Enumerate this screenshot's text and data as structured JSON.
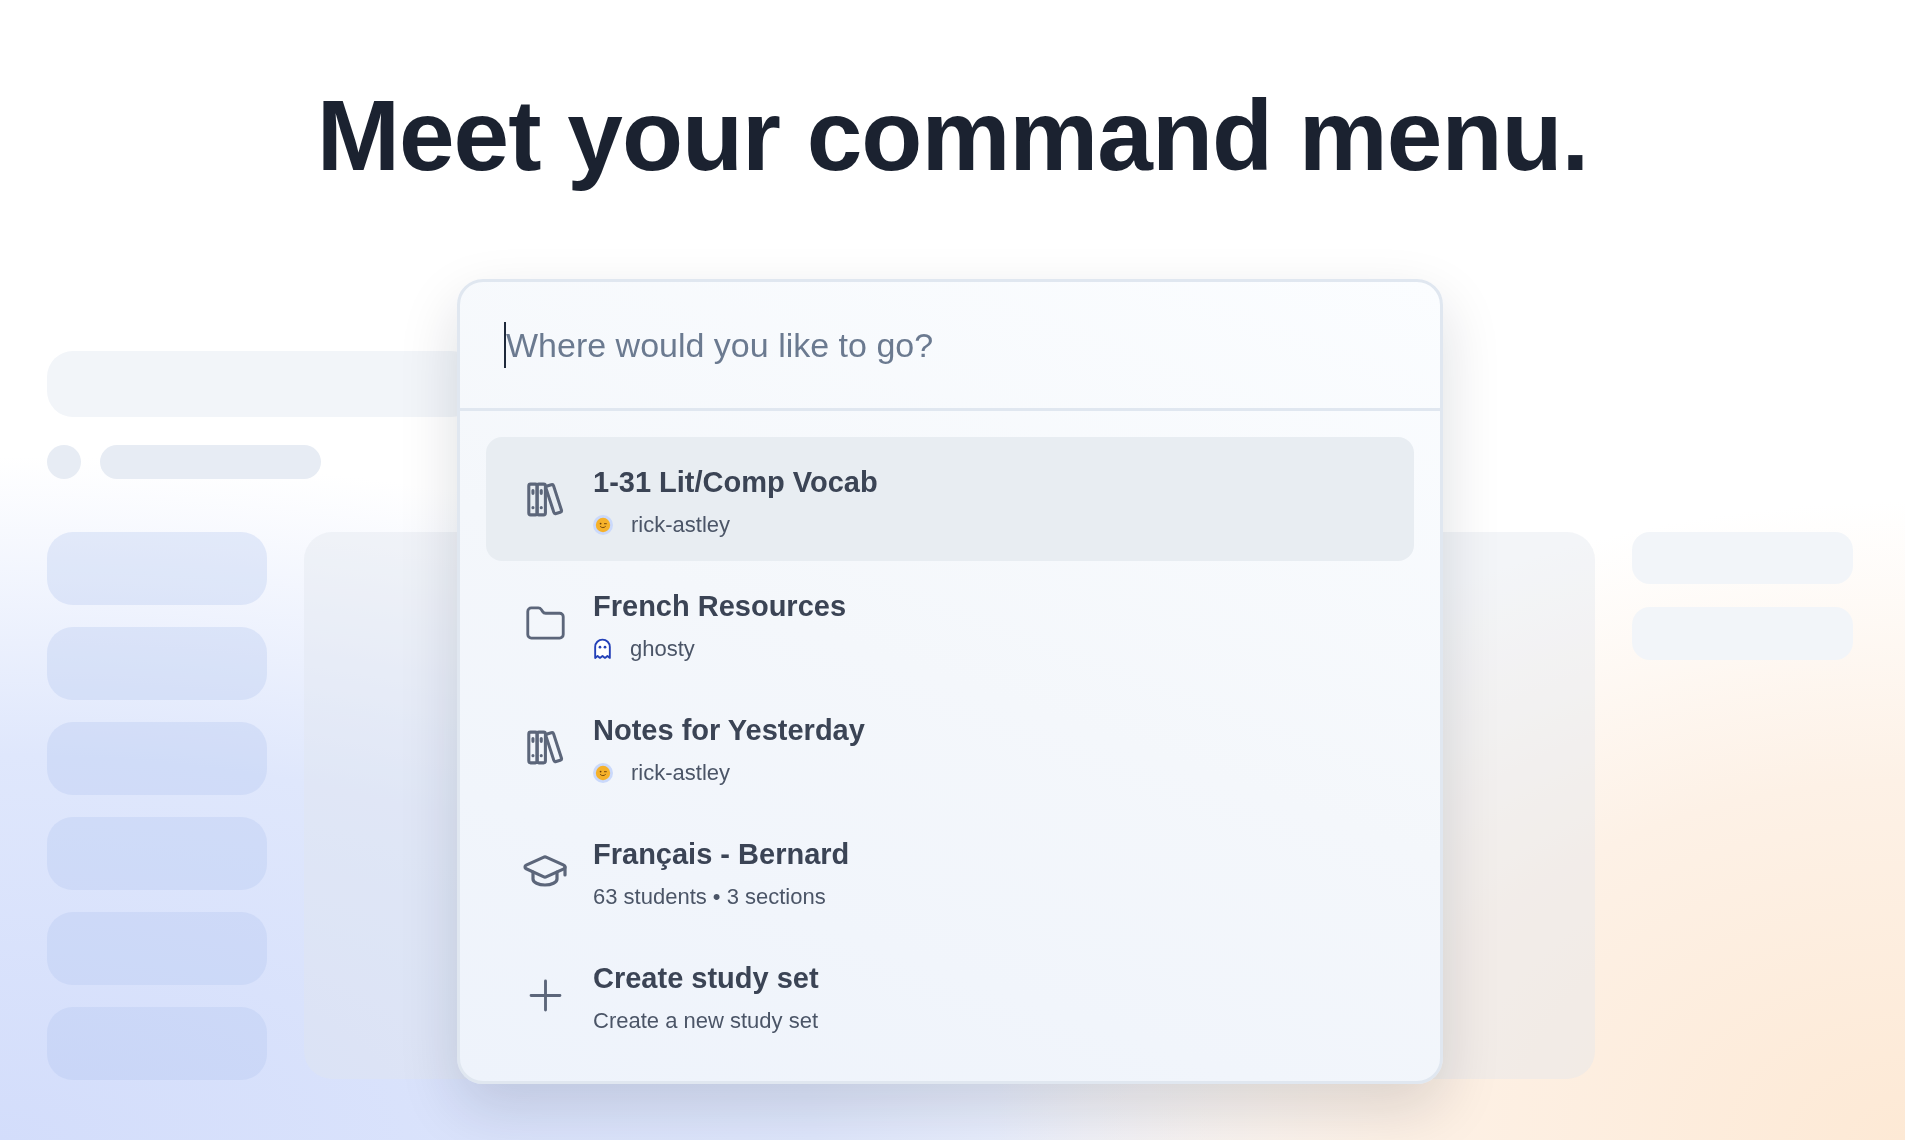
{
  "heading": "Meet your command menu.",
  "search": {
    "placeholder": "Where would you like to go?",
    "focused": true
  },
  "items": [
    {
      "kind": "study_set",
      "title": "1-31 Lit/Comp Vocab",
      "owner": {
        "name": "rick-astley",
        "kind": "emoji"
      },
      "selected": true
    },
    {
      "kind": "folder",
      "title": "French Resources",
      "owner": {
        "name": "ghosty",
        "kind": "ghost"
      },
      "selected": false
    },
    {
      "kind": "study_set",
      "title": "Notes for Yesterday",
      "owner": {
        "name": "rick-astley",
        "kind": "emoji"
      },
      "selected": false
    },
    {
      "kind": "class",
      "title": "Français - Bernard",
      "detail": "63 students • 3 sections",
      "selected": false
    },
    {
      "kind": "create",
      "title": "Create study set",
      "detail": "Create a new study set",
      "selected": false
    }
  ]
}
